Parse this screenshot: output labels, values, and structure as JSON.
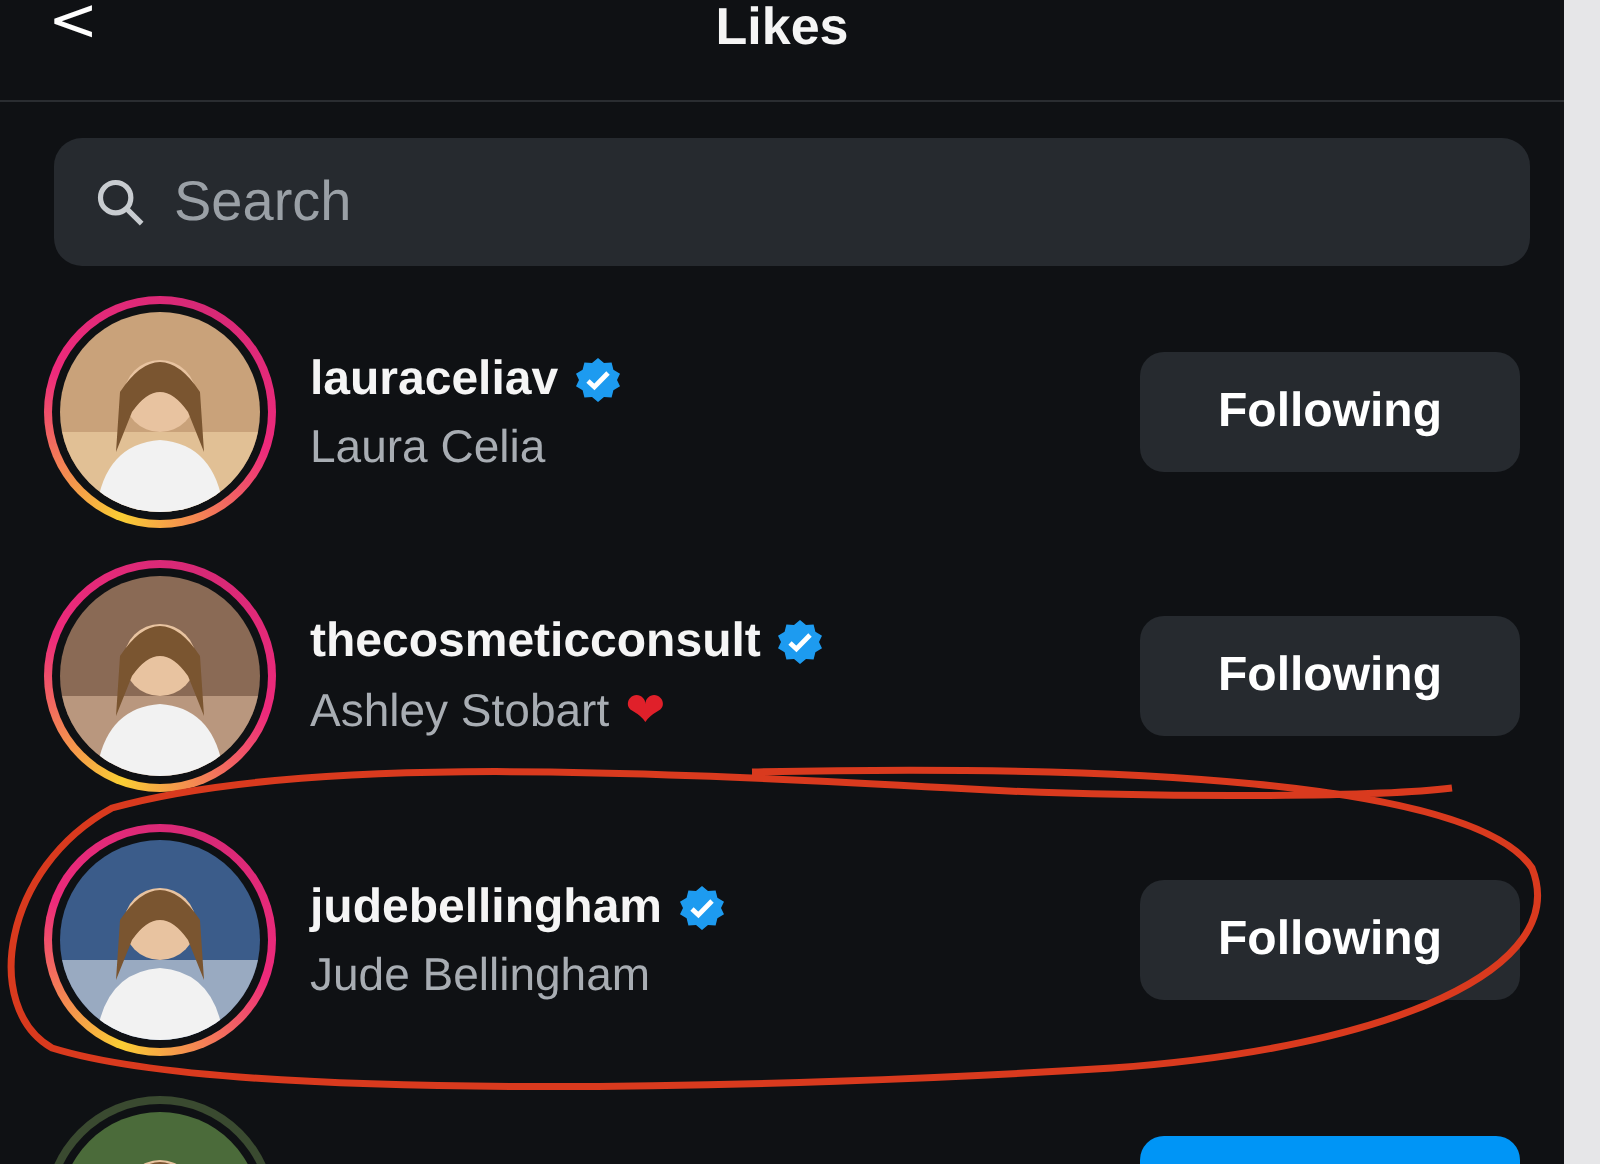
{
  "header": {
    "back": "<",
    "title": "Likes"
  },
  "search": {
    "placeholder": "Search"
  },
  "rows": [
    {
      "kind": "user",
      "username": "lauraceliav",
      "verified": true,
      "name": "Laura Celia",
      "button": "Following",
      "following": true,
      "highlighted": false
    },
    {
      "kind": "user",
      "username": "thecosmeticconsult",
      "verified": true,
      "name": "Ashley Stobart",
      "emoji": "❤",
      "button": "Following",
      "following": true,
      "highlighted": false
    },
    {
      "kind": "user",
      "username": "judebellingham",
      "verified": true,
      "name": "Jude Bellingham",
      "button": "Following",
      "following": true,
      "highlighted": true
    },
    {
      "kind": "partial",
      "following": false
    }
  ]
}
